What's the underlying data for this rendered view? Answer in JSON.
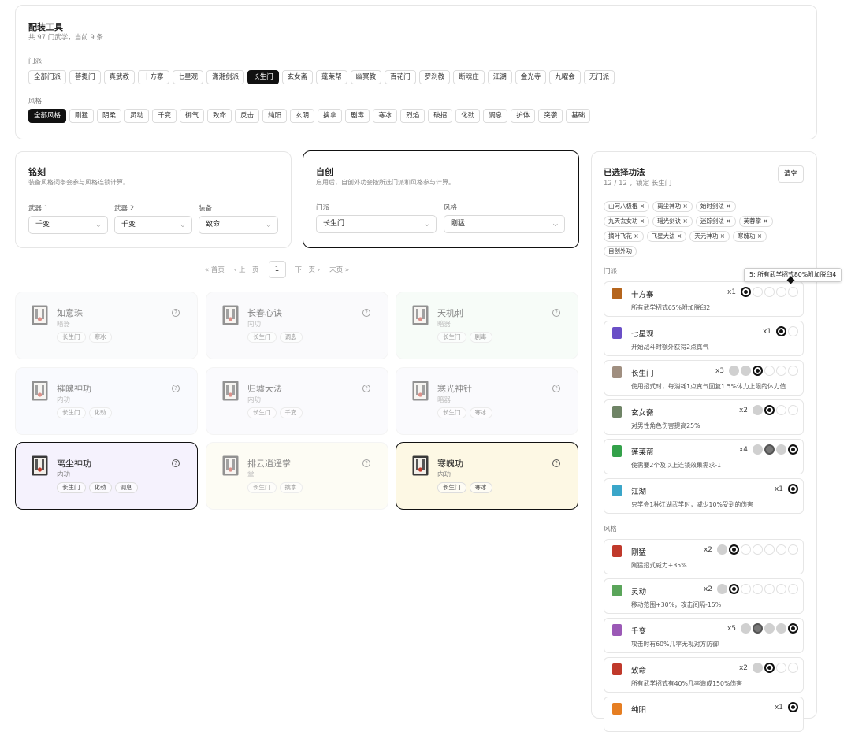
{
  "filter": {
    "title": "配装工具",
    "summary": "共 97 门武学，当前 9 条",
    "sect_label": "门派",
    "sects": [
      "全部门派",
      "菩提门",
      "真武教",
      "十方寨",
      "七星观",
      "潇湘剑派",
      "长生门",
      "玄女斋",
      "蓬莱帮",
      "幽冥教",
      "百花门",
      "罗刹教",
      "断魂庄",
      "江湖",
      "金光寺",
      "九曜会",
      "无门派"
    ],
    "sect_selected": 6,
    "style_label": "风格",
    "styles": [
      "全部风格",
      "刚猛",
      "阴柔",
      "灵动",
      "千变",
      "御气",
      "致命",
      "反击",
      "纯阳",
      "玄阴",
      "擒拿",
      "剧毒",
      "寒冰",
      "烈焰",
      "破招",
      "化劲",
      "调息",
      "护体",
      "突袭",
      "基础"
    ],
    "style_selected": 0
  },
  "inscription": {
    "title": "铭刻",
    "desc": "装备风格词条会参与风格连锁计算。",
    "weapon1_label": "武器 1",
    "weapon1": "千变",
    "weapon2_label": "武器 2",
    "weapon2": "千变",
    "gear_label": "装备",
    "gear": "致命"
  },
  "custom": {
    "title": "自创",
    "desc": "启用后，自创外功会按所选门派和风格参与计算。",
    "sect_label": "门派",
    "sect": "长生门",
    "style_label": "风格",
    "style": "刚猛"
  },
  "pager": {
    "first": "« 首页",
    "prev": "‹ 上一页",
    "current": "1",
    "next": "下一页 ›",
    "last": "末页 »"
  },
  "items": [
    {
      "name": "如意珠",
      "type": "暗器",
      "tags": [
        "长生门",
        "寒冰"
      ],
      "state": "dim",
      "bg": "#f6f8fb"
    },
    {
      "name": "长春心诀",
      "type": "内功",
      "tags": [
        "长生门",
        "调息"
      ],
      "state": "dim",
      "bg": "#f6f7fb"
    },
    {
      "name": "天机刺",
      "type": "暗器",
      "tags": [
        "长生门",
        "剧毒"
      ],
      "state": "dim",
      "bg": "#f1fbf4"
    },
    {
      "name": "摧魄神功",
      "type": "内功",
      "tags": [
        "长生门",
        "化劲"
      ],
      "state": "dim",
      "bg": "#f5f7fe"
    },
    {
      "name": "归墟大法",
      "type": "内功",
      "tags": [
        "长生门",
        "千变"
      ],
      "state": "dim",
      "bg": "#f7f6fc"
    },
    {
      "name": "寒光神针",
      "type": "暗器",
      "tags": [
        "长生门",
        "寒冰"
      ],
      "state": "dim",
      "bg": "#f7f6fc"
    },
    {
      "name": "离尘神功",
      "type": "内功",
      "tags": [
        "长生门",
        "化劲",
        "调息"
      ],
      "state": "act",
      "bg": "#f5f2fd"
    },
    {
      "name": "排云逍遥掌",
      "type": "掌",
      "tags": [
        "长生门",
        "擒拿"
      ],
      "state": "dim",
      "bg": "#fdfaec"
    },
    {
      "name": "寒魄功",
      "type": "内功",
      "tags": [
        "长生门",
        "寒冰"
      ],
      "state": "act",
      "bg": "#fdf8e4"
    }
  ],
  "help_glyph": "?",
  "selected": {
    "title": "已选择功法",
    "count": "12 / 12 ，锁定 长生门",
    "clear": "清空",
    "chips": [
      [
        "山河八极棍 ×",
        "离尘神功 ×",
        "始时剑法 ×"
      ],
      [
        "九天玄女功 ×",
        "瑶光剑诀 ×",
        "迷踪剑法 ×",
        "芙蓉掌 ×"
      ],
      [
        "摘叶飞花 ×",
        "飞星大法 ×",
        "天元神功 ×",
        "寒魄功 ×"
      ],
      [
        "自创外功"
      ]
    ],
    "sect_header": "门派",
    "style_header": "风格",
    "tooltip": "5: 所有武学招式80%附加脱臼4",
    "sect_syn": [
      {
        "name": "十方寨",
        "count": "x1",
        "desc": "所有武学招式65%附加脱臼2",
        "dots": [
          "b",
          "e",
          "e",
          "e",
          "e"
        ],
        "color": "#b5651d"
      },
      {
        "name": "七星观",
        "count": "x1",
        "desc": "开始战斗时额外获得2点真气",
        "dots": [
          "b",
          "e"
        ],
        "color": "#6a4fc7"
      },
      {
        "name": "长生门",
        "count": "x3",
        "desc": "使用招式时，每消耗1点真气回复1.5%体力上限的体力值",
        "dots": [
          "g",
          "g",
          "b",
          "e",
          "e",
          "e"
        ],
        "color": "#a08f80"
      },
      {
        "name": "玄女斋",
        "count": "x2",
        "desc": "对男性角色伤害提高25%",
        "dots": [
          "g",
          "b",
          "e",
          "e"
        ],
        "color": "#6f8466"
      },
      {
        "name": "蓬莱帮",
        "count": "x4",
        "desc": "使需要2个及以上连锁效果需求-1",
        "dots": [
          "g",
          "gd",
          "g",
          "b"
        ],
        "color": "#33a14a"
      },
      {
        "name": "江湖",
        "count": "x1",
        "desc": "只学会1种江湖武学时，减少10%受到的伤害",
        "dots": [
          "b"
        ],
        "color": "#3aa6c9"
      }
    ],
    "style_syn": [
      {
        "name": "刚猛",
        "count": "x2",
        "desc": "刚猛招式威力+35%",
        "dots": [
          "g",
          "b",
          "e",
          "e",
          "e",
          "e",
          "e"
        ],
        "color": "#c0392b"
      },
      {
        "name": "灵动",
        "count": "x2",
        "desc": "移动范围+30%，攻击间隔-15%",
        "dots": [
          "g",
          "b",
          "e",
          "e",
          "e",
          "e",
          "e"
        ],
        "color": "#5aa55a"
      },
      {
        "name": "千变",
        "count": "x5",
        "desc": "攻击时有60%几率无视对方防御",
        "dots": [
          "g",
          "gd",
          "g",
          "g",
          "b"
        ],
        "color": "#9b59b6"
      },
      {
        "name": "致命",
        "count": "x2",
        "desc": "所有武学招式有40%几率造成150%伤害",
        "dots": [
          "g",
          "b",
          "e",
          "e"
        ],
        "color": "#c0392b"
      },
      {
        "name": "纯阳",
        "count": "x1",
        "desc": "",
        "dots": [
          "b"
        ],
        "color": "#e67e22"
      }
    ]
  }
}
